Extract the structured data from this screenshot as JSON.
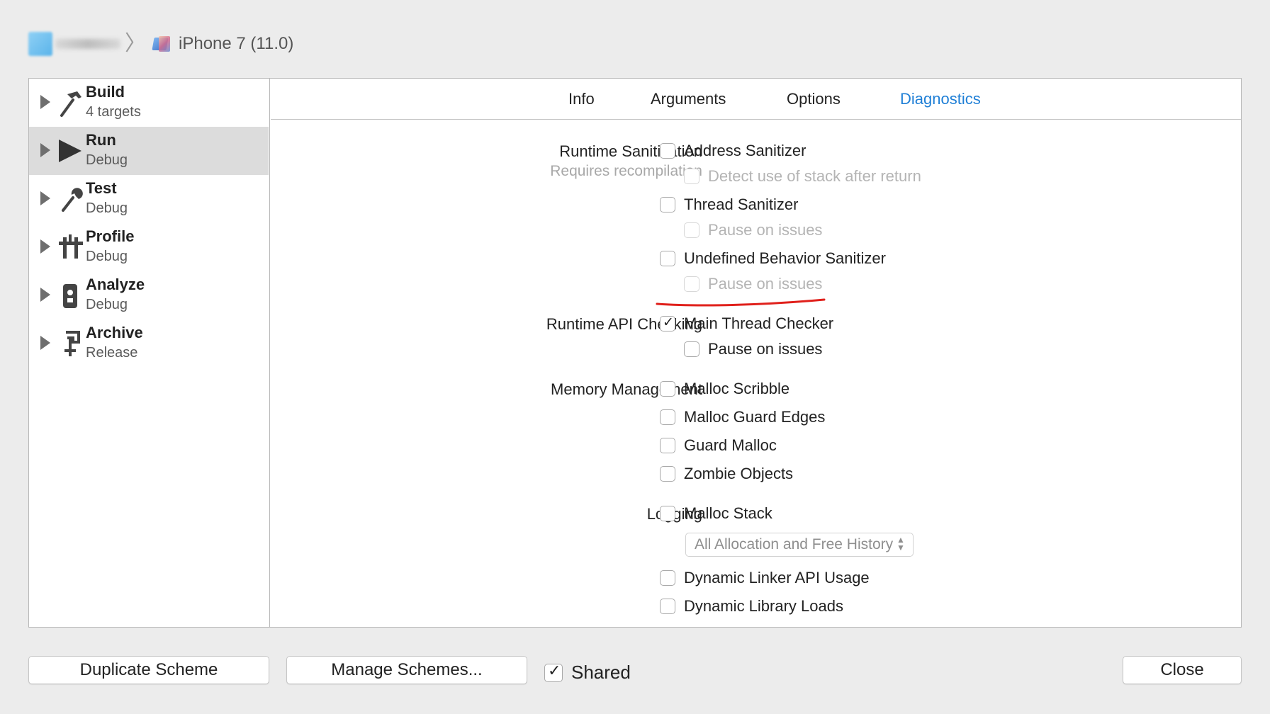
{
  "breadcrumb": {
    "device": "iPhone 7 (11.0)"
  },
  "sidebar": {
    "actions": [
      {
        "title": "Build",
        "subtitle": "4 targets",
        "icon": "hammer-icon"
      },
      {
        "title": "Run",
        "subtitle": "Debug",
        "icon": "play-icon"
      },
      {
        "title": "Test",
        "subtitle": "Debug",
        "icon": "wrench-icon"
      },
      {
        "title": "Profile",
        "subtitle": "Debug",
        "icon": "tuning-fork-icon"
      },
      {
        "title": "Analyze",
        "subtitle": "Debug",
        "icon": "analyze-icon"
      },
      {
        "title": "Archive",
        "subtitle": "Release",
        "icon": "archive-icon"
      }
    ],
    "selected": "Run"
  },
  "tabs": [
    "Info",
    "Arguments",
    "Options",
    "Diagnostics"
  ],
  "active_tab": "Diagnostics",
  "sections": {
    "runtime_sanitization": {
      "label": "Runtime Sanitization",
      "note": "Requires recompilation",
      "address_sanitizer": "Address Sanitizer",
      "detect_stack": "Detect use of stack after return",
      "thread_sanitizer": "Thread Sanitizer",
      "thread_pause": "Pause on issues",
      "ub_sanitizer": "Undefined Behavior Sanitizer",
      "ub_pause": "Pause on issues"
    },
    "runtime_api": {
      "label": "Runtime API Checking",
      "main_thread_checker": "Main Thread Checker",
      "pause": "Pause on issues"
    },
    "memory": {
      "label": "Memory Management",
      "malloc_scribble": "Malloc Scribble",
      "malloc_guard_edges": "Malloc Guard Edges",
      "guard_malloc": "Guard Malloc",
      "zombie_objects": "Zombie Objects"
    },
    "logging": {
      "label": "Logging",
      "malloc_stack": "Malloc Stack",
      "history_select": "All Allocation and Free History",
      "dyld_api": "Dynamic Linker API Usage",
      "dyld_loads": "Dynamic Library Loads"
    }
  },
  "checked": {
    "main_thread_checker": true,
    "shared": true
  },
  "footer": {
    "duplicate": "Duplicate Scheme",
    "manage": "Manage Schemes...",
    "shared": "Shared",
    "close": "Close"
  },
  "colors": {
    "accent": "#1f7fd6",
    "annotation": "#e0201b"
  }
}
